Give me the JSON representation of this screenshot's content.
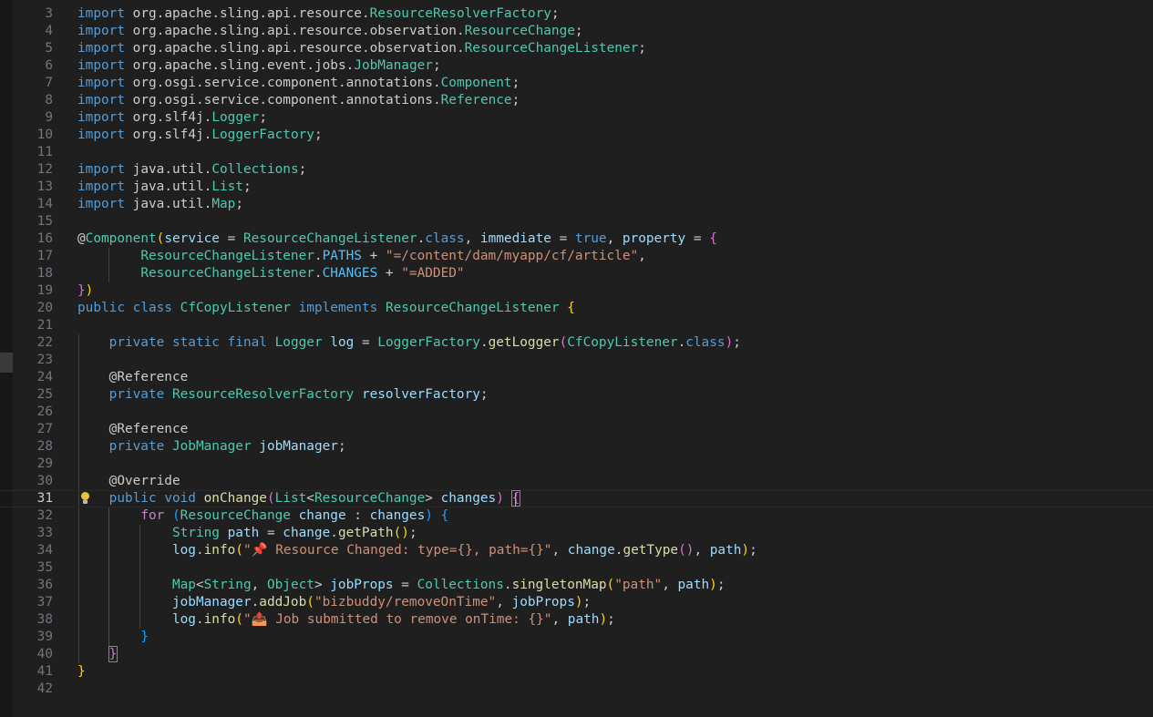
{
  "editor": {
    "language": "java",
    "colors": {
      "background": "#1f1f1f",
      "keyword": "#569cd6",
      "control": "#c586c0",
      "type": "#4ec9b0",
      "function": "#dcdcaa",
      "variable": "#9cdcfe",
      "string": "#ce9178",
      "constant": "#4fc1ff",
      "line_number": "#6e7681"
    },
    "current_line": 31,
    "lightbulb_icon": "lightbulb-icon",
    "lines": [
      {
        "n": "3",
        "text": "import org.apache.sling.api.resource.ResourceResolverFactory;"
      },
      {
        "n": "4",
        "text": "import org.apache.sling.api.resource.observation.ResourceChange;"
      },
      {
        "n": "5",
        "text": "import org.apache.sling.api.resource.observation.ResourceChangeListener;"
      },
      {
        "n": "6",
        "text": "import org.apache.sling.event.jobs.JobManager;"
      },
      {
        "n": "7",
        "text": "import org.osgi.service.component.annotations.Component;"
      },
      {
        "n": "8",
        "text": "import org.osgi.service.component.annotations.Reference;"
      },
      {
        "n": "9",
        "text": "import org.slf4j.Logger;"
      },
      {
        "n": "10",
        "text": "import org.slf4j.LoggerFactory;"
      },
      {
        "n": "11",
        "text": ""
      },
      {
        "n": "12",
        "text": "import java.util.Collections;"
      },
      {
        "n": "13",
        "text": "import java.util.List;"
      },
      {
        "n": "14",
        "text": "import java.util.Map;"
      },
      {
        "n": "15",
        "text": ""
      },
      {
        "n": "16",
        "text": "@Component(service = ResourceChangeListener.class, immediate = true, property = {"
      },
      {
        "n": "17",
        "text": "        ResourceChangeListener.PATHS + \"=/content/dam/myapp/cf/article\","
      },
      {
        "n": "18",
        "text": "        ResourceChangeListener.CHANGES + \"=ADDED\""
      },
      {
        "n": "19",
        "text": "})"
      },
      {
        "n": "20",
        "text": "public class CfCopyListener implements ResourceChangeListener {"
      },
      {
        "n": "21",
        "text": ""
      },
      {
        "n": "22",
        "text": "    private static final Logger log = LoggerFactory.getLogger(CfCopyListener.class);"
      },
      {
        "n": "23",
        "text": ""
      },
      {
        "n": "24",
        "text": "    @Reference"
      },
      {
        "n": "25",
        "text": "    private ResourceResolverFactory resolverFactory;"
      },
      {
        "n": "26",
        "text": ""
      },
      {
        "n": "27",
        "text": "    @Reference"
      },
      {
        "n": "28",
        "text": "    private JobManager jobManager;"
      },
      {
        "n": "29",
        "text": ""
      },
      {
        "n": "30",
        "text": "    @Override"
      },
      {
        "n": "31",
        "text": "    public void onChange(List<ResourceChange> changes) {"
      },
      {
        "n": "32",
        "text": "        for (ResourceChange change : changes) {"
      },
      {
        "n": "33",
        "text": "            String path = change.getPath();"
      },
      {
        "n": "34",
        "text": "            log.info(\"📌 Resource Changed: type={}, path={}\", change.getType(), path);"
      },
      {
        "n": "35",
        "text": ""
      },
      {
        "n": "36",
        "text": "            Map<String, Object> jobProps = Collections.singletonMap(\"path\", path);"
      },
      {
        "n": "37",
        "text": "            jobManager.addJob(\"bizbuddy/removeOnTime\", jobProps);"
      },
      {
        "n": "38",
        "text": "            log.info(\"📤 Job submitted to remove onTime: {}\", path);"
      },
      {
        "n": "39",
        "text": "        }"
      },
      {
        "n": "40",
        "text": "    }"
      },
      {
        "n": "41",
        "text": "}"
      },
      {
        "n": "42",
        "text": ""
      }
    ]
  }
}
